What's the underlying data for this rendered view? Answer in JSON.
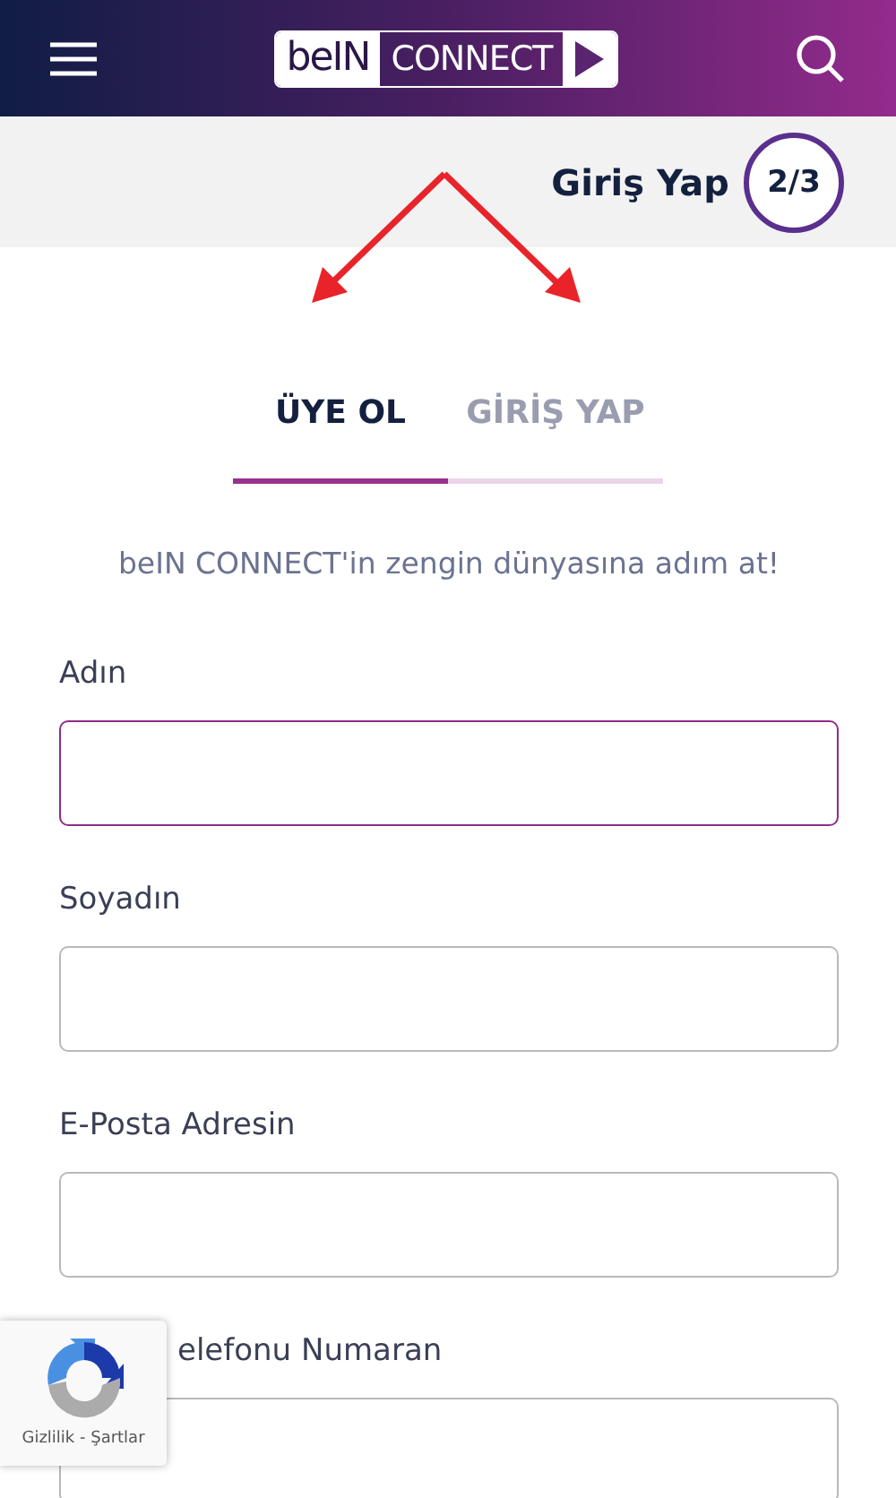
{
  "header": {
    "logo_left": "beIN",
    "logo_right": "CONNECT"
  },
  "step_bar": {
    "label": "Giriş Yap",
    "step": "2/3"
  },
  "tabs": [
    {
      "label": "ÜYE OL",
      "selected": true
    },
    {
      "label": "GİRİŞ YAP",
      "selected": false
    }
  ],
  "subtitle": "beIN CONNECT'in zengin dünyasına adım at!",
  "fields": [
    {
      "label": "Adın",
      "focused": true
    },
    {
      "label": "Soyadın",
      "focused": false
    },
    {
      "label": "E-Posta Adresin",
      "focused": false
    },
    {
      "label": "elefonu Numaran",
      "focused": false
    }
  ],
  "recaptcha": {
    "links": "Gizlilik - Şartlar"
  }
}
